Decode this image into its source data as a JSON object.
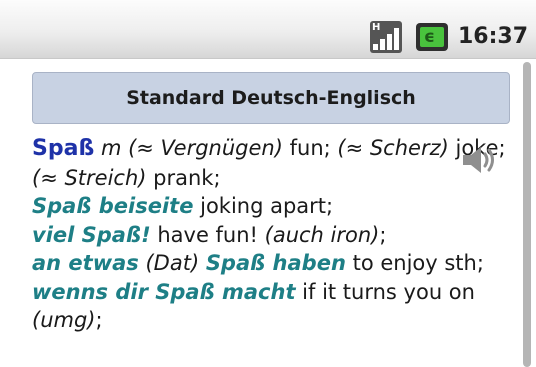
{
  "status_bar": {
    "signal_icon_label": "H",
    "time": "16:37",
    "colors": {
      "battery": "#49c33d"
    }
  },
  "header": {
    "title": "Standard Deutsch-Englisch"
  },
  "entry": {
    "headword": "Spaß",
    "gender": " m ",
    "s1_note": "(≈ Vergnügen)",
    "s1_trans": " fun; ",
    "s2_note": "(≈ Scherz)",
    "s2_trans": " joke; ",
    "s3_note": "(≈ Streich)",
    "s3_trans": " prank;",
    "p1_phrase": "Spaß beiseite",
    "p1_trans": " joking apart;",
    "p2_phrase": "viel Spaß!",
    "p2_trans": " have fun! ",
    "p2_note": "(auch iron)",
    "p2_end": ";",
    "p3_phrase_a": "an etwas",
    "p3_note": " (Dat) ",
    "p3_phrase_b": "Spaß haben",
    "p3_trans": " to enjoy sth;",
    "p4_phrase": "wenns dir Spaß macht",
    "p4_trans": " if it turns you on",
    "p4_note": "(umg)",
    "p4_end": ";",
    "colors": {
      "headword": "#1e32a8",
      "phrase": "#1e7f86"
    }
  },
  "icons": {
    "speaker": "speaker-icon",
    "signal": "signal-icon",
    "battery": "battery-icon"
  }
}
